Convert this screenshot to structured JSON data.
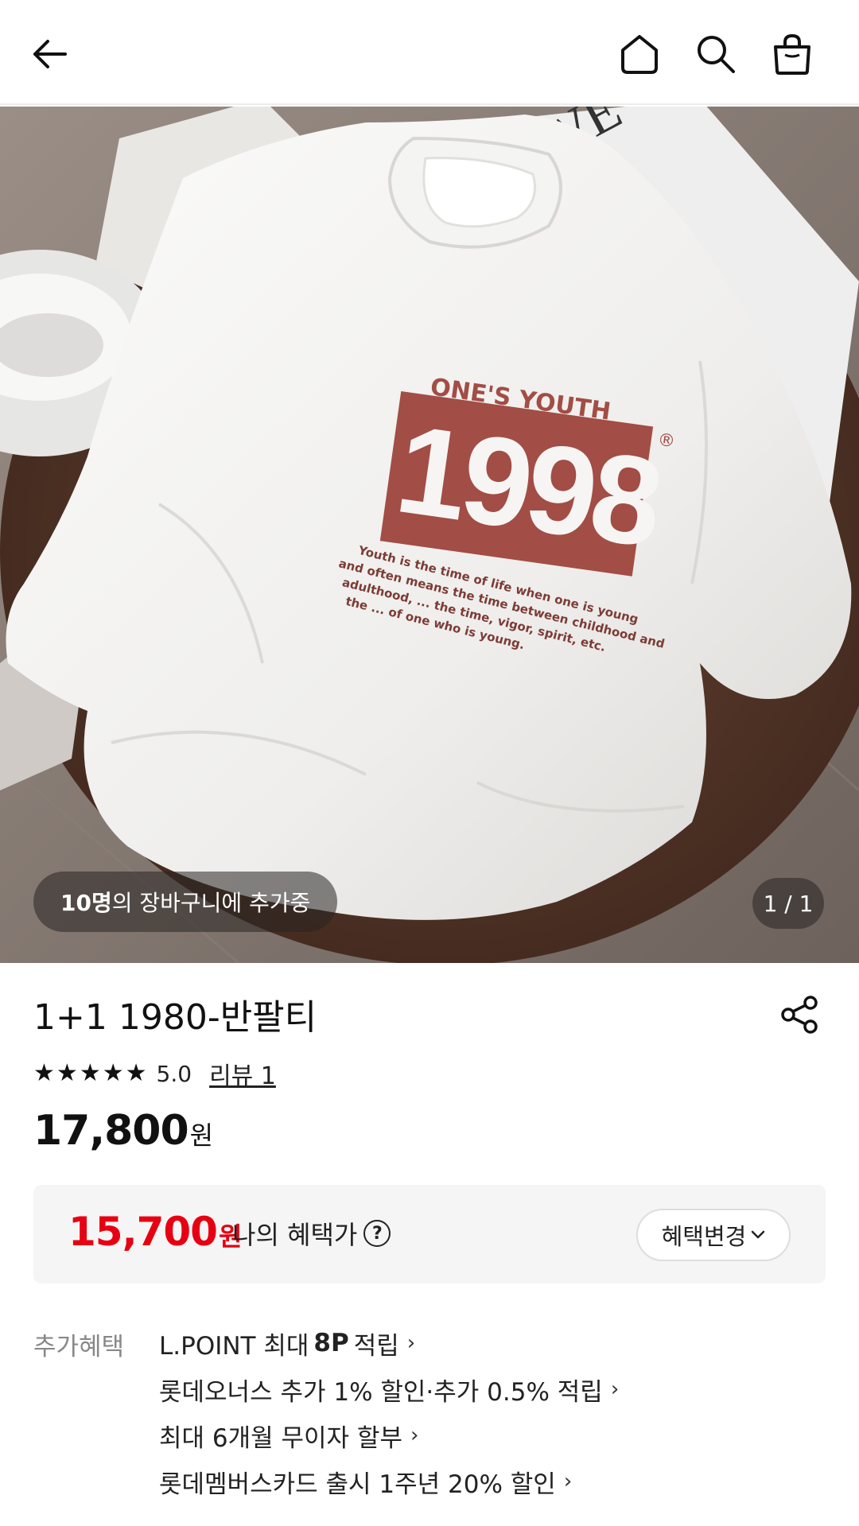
{
  "header": {
    "icons": [
      "back-arrow-icon",
      "home-icon",
      "search-icon",
      "shopping-bag-icon"
    ]
  },
  "hero": {
    "cart_count": "10명",
    "cart_text": "의 장바구니에 추가중",
    "page_indicator": "1 / 1",
    "print": {
      "top_text": "ONE'S YOUTH",
      "year": "1998",
      "mark": "®",
      "body_lines": [
        "Youth is the time of life when one is young",
        "and often means the time between childhood and",
        "adulthood, ... the time, vigor, spirit, etc.",
        "the ... of one who is young."
      ]
    }
  },
  "product": {
    "title": "1+1 1980-반팔티",
    "rating": "5.0",
    "stars": 5,
    "review_link": "리뷰 1",
    "price": "17,800",
    "price_unit": "원"
  },
  "benefit": {
    "price": "15,700",
    "unit": "원",
    "label": "나의 혜택가",
    "help": "?",
    "change_button": "혜택변경"
  },
  "extra": {
    "label": "추가혜택",
    "items": [
      {
        "pre": "L.POINT 최대",
        "bold": "8P",
        "post": "적립"
      },
      {
        "text": "롯데오너스 추가 1% 할인·추가 0.5% 적립"
      },
      {
        "text": "최대 6개월 무이자 할부"
      },
      {
        "text": "롯데멤버스카드 출시 1주년 20% 할인"
      }
    ]
  },
  "colors": {
    "accent_red": "#e60012",
    "print_red": "#a24d45"
  }
}
